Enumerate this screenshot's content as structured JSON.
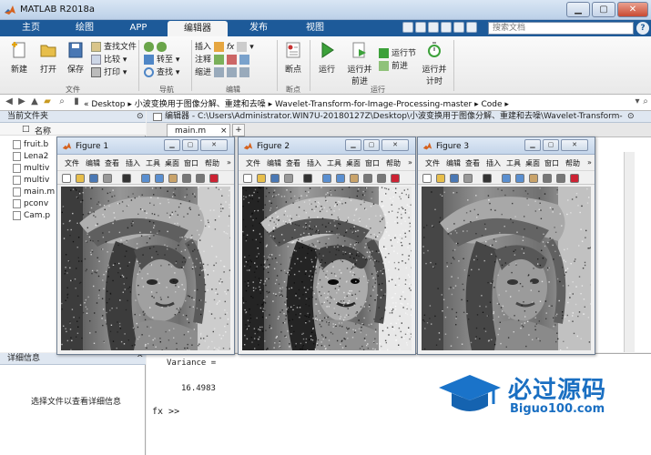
{
  "window": {
    "title": "MATLAB R2018a"
  },
  "ribbon": {
    "tabs": [
      {
        "label": "主页"
      },
      {
        "label": "绘图"
      },
      {
        "label": "APP"
      },
      {
        "label": "编辑器"
      },
      {
        "label": "发布"
      },
      {
        "label": "视图"
      }
    ],
    "search_placeholder": "搜索文档",
    "groups": {
      "file": "文件",
      "navigate": "导航",
      "edit": "编辑",
      "breakpoints": "断点",
      "run": "运行"
    },
    "buttons": {
      "new": "新建",
      "open": "打开",
      "save": "保存",
      "find_files": "查找文件",
      "compare": "比较",
      "print": "打印",
      "goto": "转至",
      "find": "查找",
      "insert": "插入",
      "comment": "注释",
      "indent": "缩进",
      "breakpoints": "断点",
      "run": "运行",
      "run_and_advance": [
        "运行并",
        "前进"
      ],
      "run_section": "运行节",
      "advance": "前进",
      "run_and_time": [
        "运行并",
        "计时"
      ]
    }
  },
  "address": {
    "path": [
      "«",
      "Desktop",
      "小波变换用于图像分解、重建和去噪",
      "Wavelet-Transform-for-Image-Processing-master",
      "Code"
    ]
  },
  "current_folder": {
    "title": "当前文件夹",
    "column_name": "名称",
    "files": [
      "fruit.b",
      "Lena2",
      "multiv",
      "multiv",
      "main.m",
      "pconv",
      "Cam.p"
    ]
  },
  "details": {
    "title": "详细信息",
    "empty_text": "选择文件以查看详细信息"
  },
  "editor": {
    "title": "编辑器 - C:\\Users\\Administrator.WIN7U-20180127Z\\Desktop\\小波变换用于图像分解、重建和去噪\\Wavelet-Transform-",
    "tab": "main.m"
  },
  "command_window": {
    "lines": [
      "Variance =",
      "16.4983"
    ],
    "prompt": "fx >>"
  },
  "figures": [
    {
      "title": "Figure 1",
      "noise": 0.16,
      "contrast": 1.0
    },
    {
      "title": "Figure 2",
      "noise": 0.3,
      "contrast": 1.35
    },
    {
      "title": "Figure 3",
      "noise": 0.1,
      "contrast": 0.85
    }
  ],
  "figure_menus": [
    "文件",
    "编辑",
    "查看",
    "插入",
    "工具",
    "桌面",
    "窗口",
    "帮助"
  ],
  "watermark": {
    "brand": "必过源码",
    "url": "Biguo100.com"
  },
  "colors": {
    "ribbon_blue": "#1d5a99",
    "title_gradient": "#bcd0e8"
  }
}
